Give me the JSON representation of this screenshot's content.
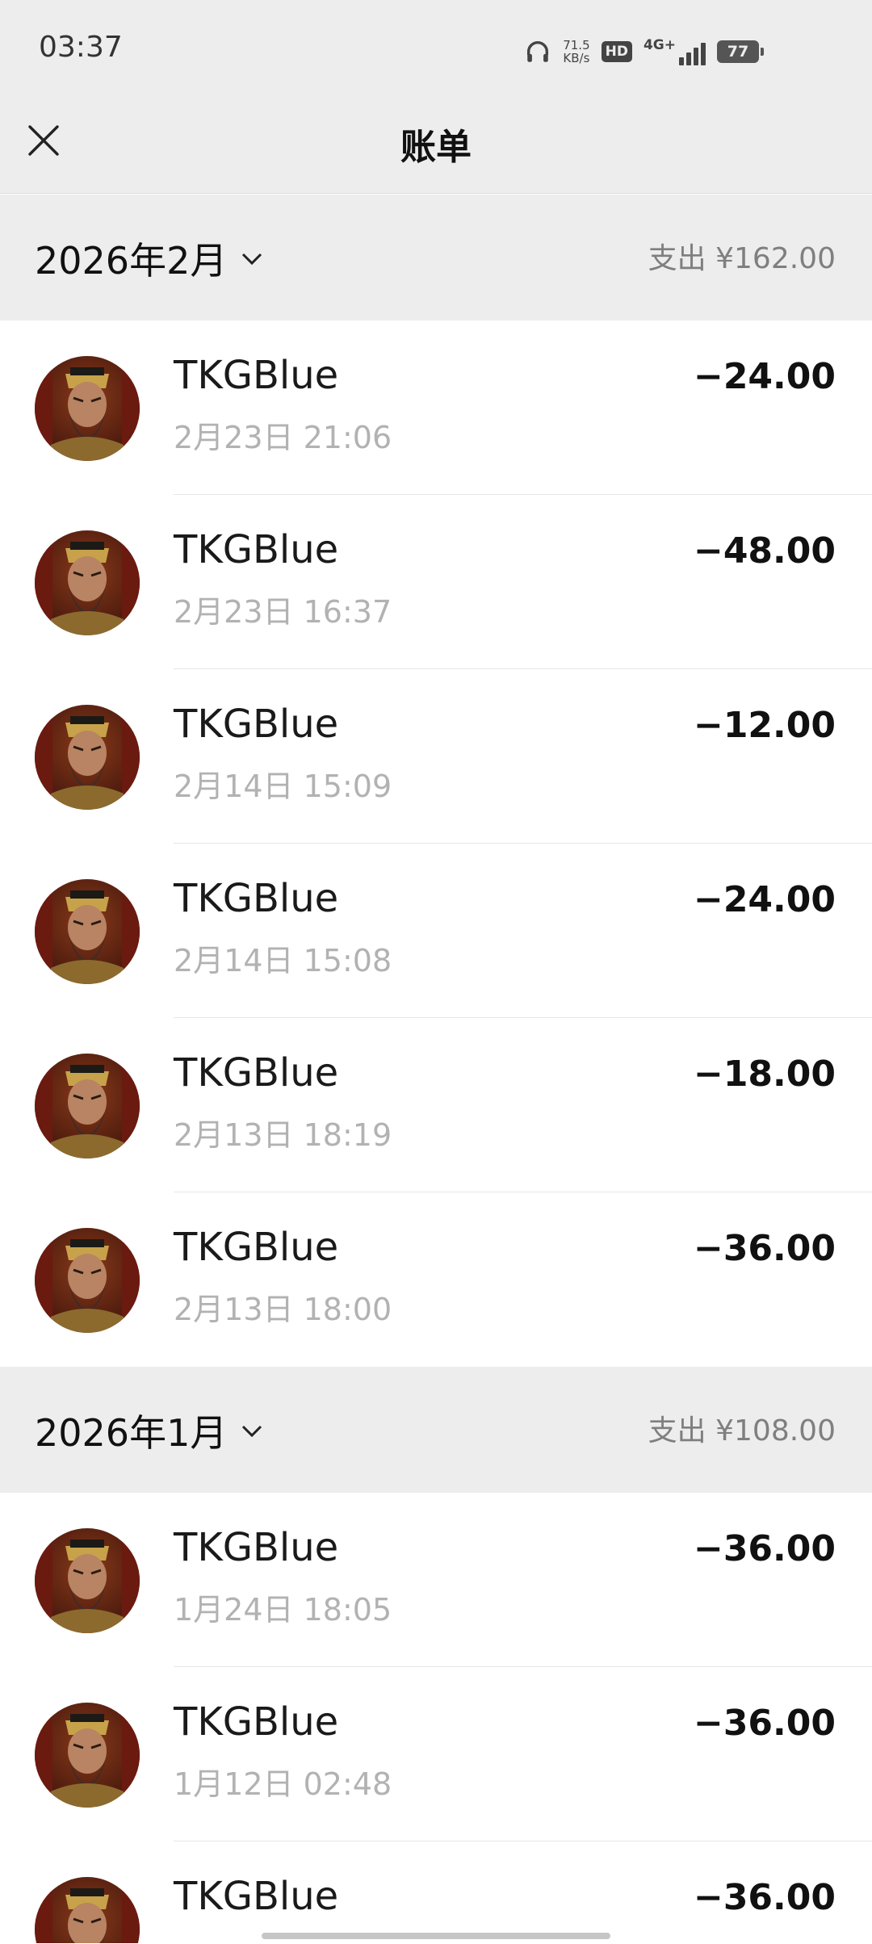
{
  "status": {
    "time": "03:37",
    "net_speed_value": "71.5",
    "net_speed_unit": "KB/s",
    "hd_label": "HD",
    "network_type": "4G+",
    "battery": "77"
  },
  "nav": {
    "title": "账单",
    "close_icon": "close-icon"
  },
  "months": [
    {
      "label": "2026年2月",
      "total": "支出 ¥162.00",
      "transactions": [
        {
          "name": "TKGBlue",
          "time": "2月23日 21:06",
          "amount": "−24.00"
        },
        {
          "name": "TKGBlue",
          "time": "2月23日 16:37",
          "amount": "−48.00"
        },
        {
          "name": "TKGBlue",
          "time": "2月14日 15:09",
          "amount": "−12.00"
        },
        {
          "name": "TKGBlue",
          "time": "2月14日 15:08",
          "amount": "−24.00"
        },
        {
          "name": "TKGBlue",
          "time": "2月13日 18:19",
          "amount": "−18.00"
        },
        {
          "name": "TKGBlue",
          "time": "2月13日 18:00",
          "amount": "−36.00"
        }
      ]
    },
    {
      "label": "2026年1月",
      "total": "支出 ¥108.00",
      "transactions": [
        {
          "name": "TKGBlue",
          "time": "1月24日 18:05",
          "amount": "−36.00"
        },
        {
          "name": "TKGBlue",
          "time": "1月12日 02:48",
          "amount": "−36.00"
        },
        {
          "name": "TKGBlue",
          "time": "",
          "amount": "−36.00"
        }
      ]
    }
  ]
}
